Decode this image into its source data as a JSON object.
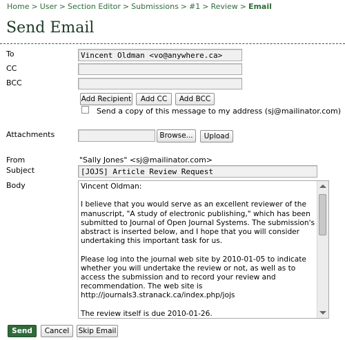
{
  "breadcrumb": {
    "items": [
      "Home",
      "User",
      "Section Editor",
      "Submissions",
      "#1",
      "Review"
    ],
    "current": "Email",
    "separator": ">"
  },
  "page_title": "Send Email",
  "form": {
    "to_label": "To",
    "to_value": "Vincent Oldman <vo@anywhere.ca>",
    "cc_label": "CC",
    "cc_value": "",
    "bcc_label": "BCC",
    "bcc_value": "",
    "add_recipient": "Add Recipient",
    "add_cc": "Add CC",
    "add_bcc": "Add BCC",
    "copy_label": "Send a copy of this message to my address (sj@mailinator.com)",
    "copy_checked": false,
    "attachments_label": "Attachments",
    "browse": "Browse...",
    "upload": "Upload",
    "from_label": "From",
    "from_value": "\"Sally Jones\" <sj@mailinator.com>",
    "subject_label": "Subject",
    "subject_value": "[JOJS] Article Review Request",
    "body_label": "Body",
    "body_value": "Vincent Oldman:\n\nI believe that you would serve as an excellent reviewer of the manuscript, \"A study of electronic publishing,\" which has been submitted to Journal of Open Journal Systems. The submission's abstract is inserted below, and I hope that you will consider undertaking this important task for us.\n\nPlease log into the journal web site by 2010-01-05 to indicate whether you will undertake the review or not, as well as to access the submission and to record your review and recommendation. The web site is http://journals3.stranack.ca/index.php/jojs\n\nThe review itself is due 2010-01-26.\n\nIf you do not have your username and password for the"
  },
  "actions": {
    "send": "Send",
    "cancel": "Cancel",
    "skip": "Skip Email"
  },
  "colors": {
    "accent": "#2f6b3a",
    "title": "#1e3a29"
  }
}
